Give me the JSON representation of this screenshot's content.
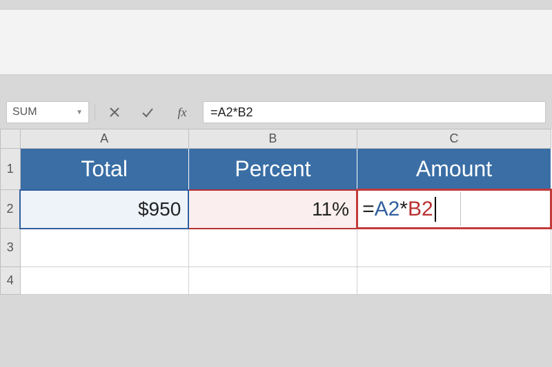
{
  "namebox": {
    "value": "SUM"
  },
  "formula_bar": {
    "value": "=A2*B2",
    "fx_label": "fx"
  },
  "columns": [
    "A",
    "B",
    "C"
  ],
  "rows": [
    "1",
    "2",
    "3",
    "4"
  ],
  "headers": {
    "A": "Total",
    "B": "Percent",
    "C": "Amount"
  },
  "data": {
    "A2": "$950",
    "B2": "11%",
    "C2_parts": {
      "eq": "=",
      "ref_a": "A2",
      "op": "*",
      "ref_b": "B2"
    }
  },
  "colors": {
    "header_bg": "#3a6ea5",
    "a2_border": "#2f5f9e",
    "b2_border": "#b93030",
    "c2_border": "#c23a3a"
  }
}
